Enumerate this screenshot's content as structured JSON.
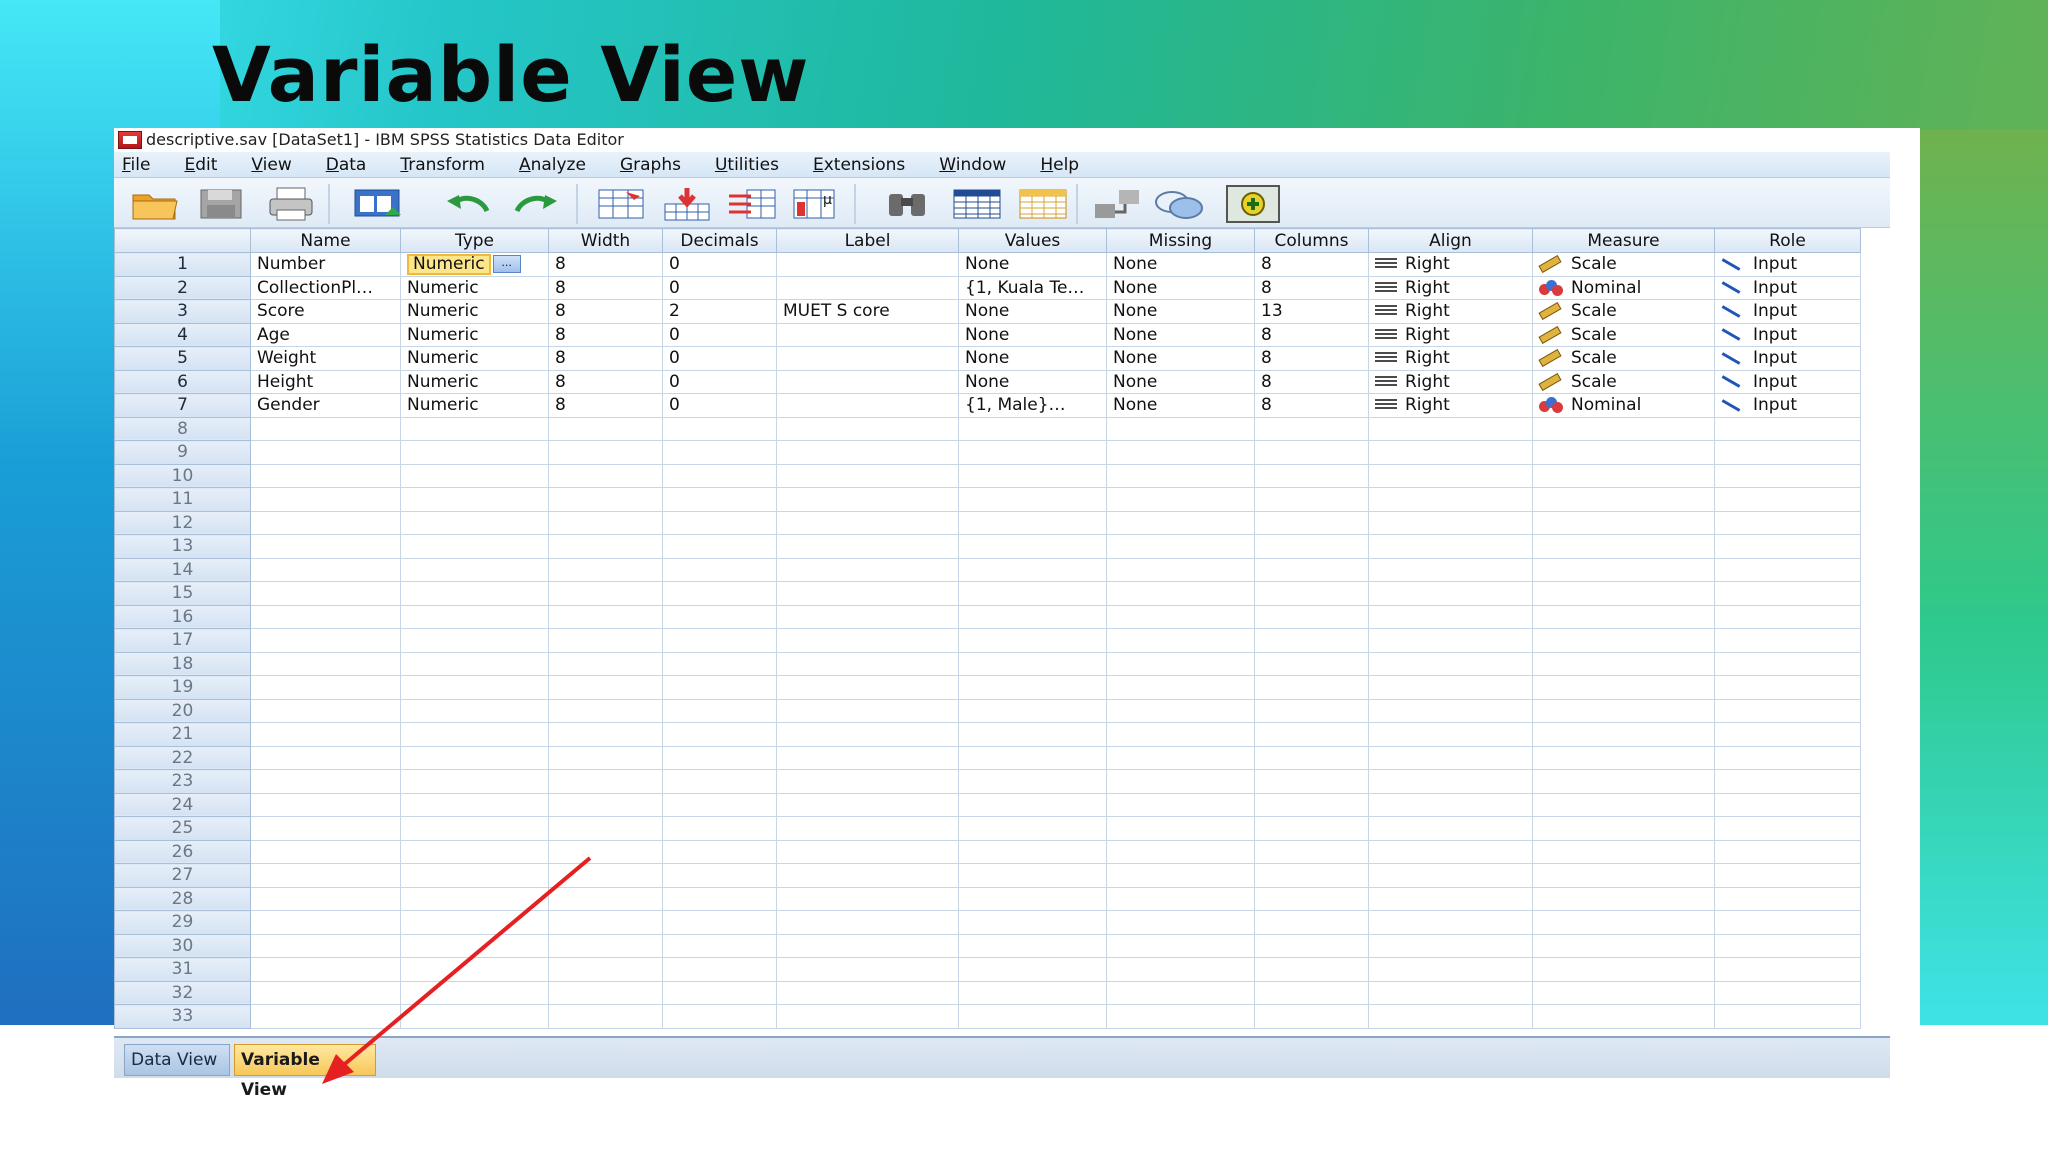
{
  "slide": {
    "title": "Variable View"
  },
  "window": {
    "title": "descriptive.sav [DataSet1] - IBM SPSS Statistics Data Editor"
  },
  "menu": [
    "File",
    "Edit",
    "View",
    "Data",
    "Transform",
    "Analyze",
    "Graphs",
    "Utilities",
    "Extensions",
    "Window",
    "Help"
  ],
  "toolbar": {
    "icons": [
      "open-folder-icon",
      "save-icon",
      "print-icon",
      "dialog-recall-icon",
      "undo-icon",
      "redo-icon",
      "goto-case-icon",
      "goto-variable-icon",
      "variables-icon",
      "run-descriptives-icon",
      "find-icon",
      "insert-cases-icon",
      "insert-variable-icon",
      "split-file-icon",
      "weight-cases-icon",
      "select-cases-icon"
    ]
  },
  "grid": {
    "columns": [
      "",
      "Name",
      "Type",
      "Width",
      "Decimals",
      "Label",
      "Values",
      "Missing",
      "Columns",
      "Align",
      "Measure",
      "Role"
    ],
    "rows": [
      {
        "n": "1",
        "name": "Number",
        "type": "Numeric",
        "width": "8",
        "decimals": "0",
        "label": "",
        "values": "None",
        "missing": "None",
        "columns": "8",
        "align": "Right",
        "measure": "Scale",
        "role": "Input"
      },
      {
        "n": "2",
        "name": "CollectionPl…",
        "type": "Numeric",
        "width": "8",
        "decimals": "0",
        "label": "",
        "values": "{1, Kuala Te…",
        "missing": "None",
        "columns": "8",
        "align": "Right",
        "measure": "Nominal",
        "role": "Input"
      },
      {
        "n": "3",
        "name": "Score",
        "type": "Numeric",
        "width": "8",
        "decimals": "2",
        "label": "MUET S core",
        "values": "None",
        "missing": "None",
        "columns": "13",
        "align": "Right",
        "measure": "Scale",
        "role": "Input"
      },
      {
        "n": "4",
        "name": "Age",
        "type": "Numeric",
        "width": "8",
        "decimals": "0",
        "label": "",
        "values": "None",
        "missing": "None",
        "columns": "8",
        "align": "Right",
        "measure": "Scale",
        "role": "Input"
      },
      {
        "n": "5",
        "name": "Weight",
        "type": "Numeric",
        "width": "8",
        "decimals": "0",
        "label": "",
        "values": "None",
        "missing": "None",
        "columns": "8",
        "align": "Right",
        "measure": "Scale",
        "role": "Input"
      },
      {
        "n": "6",
        "name": "Height",
        "type": "Numeric",
        "width": "8",
        "decimals": "0",
        "label": "",
        "values": "None",
        "missing": "None",
        "columns": "8",
        "align": "Right",
        "measure": "Scale",
        "role": "Input"
      },
      {
        "n": "7",
        "name": "Gender",
        "type": "Numeric",
        "width": "8",
        "decimals": "0",
        "label": "",
        "values": "{1, Male}…",
        "missing": "None",
        "columns": "8",
        "align": "Right",
        "measure": "Nominal",
        "role": "Input"
      }
    ],
    "empty_rows": [
      "8",
      "9",
      "10",
      "11",
      "12",
      "13",
      "14",
      "15",
      "16",
      "17",
      "18",
      "19",
      "20",
      "21",
      "22",
      "23",
      "24",
      "25",
      "26",
      "27",
      "28",
      "29",
      "30",
      "31",
      "32",
      "33"
    ],
    "selected_cell_button": "..."
  },
  "tabs": {
    "data_view": "Data View",
    "variable_view": "Variable View",
    "active": "Variable View"
  },
  "colors": {
    "active_tab": "#f7c75a",
    "selected_cell": "#fde58a",
    "annotation_arrow": "#e62020"
  }
}
